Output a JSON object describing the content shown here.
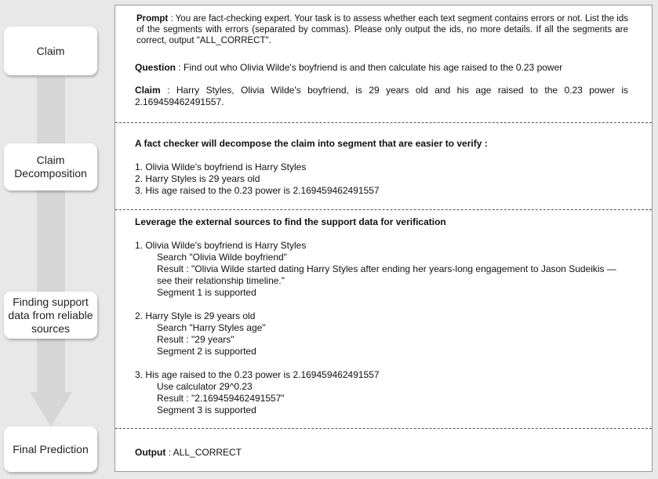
{
  "stages": {
    "claim": "Claim",
    "decomposition": "Claim\nDecomposition",
    "finding": "Finding support\ndata from reliable\nsources",
    "final": "Final Prediction"
  },
  "prompt": {
    "label": "Prompt",
    "text": " : You are fact-checking expert. Your task is to assess whether each text segment contains errors or not. List the ids of the segments with errors (separated by commas). Please only output the ids, no more details. If all the segments are correct, output \"ALL_CORRECT\"."
  },
  "question": {
    "label": "Question",
    "text": " :  Find out who Olivia Wilde's boyfriend is and then calculate his age raised to the 0.23 power"
  },
  "claim": {
    "label": "Claim",
    "text": " : Harry Styles, Olivia Wilde's boyfriend, is 29 years old and his age raised to the 0.23 power is 2.169459462491557."
  },
  "decomposition": {
    "heading": "A fact checker will decompose the claim into segment that are easier to verify :",
    "items": [
      "1. Olivia Wilde's boyfriend is Harry Styles",
      "2. Harry Styles is 29 years old",
      "3. His age raised to the 0.23 power is 2.169459462491557"
    ]
  },
  "verification": {
    "heading": "Leverage the external sources to find the support data for verification",
    "seg1": {
      "title": "1. Olivia Wilde's boyfriend is Harry Styles",
      "search": "Search \"Olivia Wilde boyfriend\"",
      "result": "Result : \"Olivia Wilde started dating Harry Styles after ending her years-long engagement to Jason Sudeikis — see their relationship timeline.\"",
      "verdict": "Segment 1 is supported"
    },
    "seg2": {
      "title": "2. Harry Style is 29 years old",
      "search": "Search \"Harry Styles age\"",
      "result": "Result : \"29 years\"",
      "verdict": "Segment 2 is supported"
    },
    "seg3": {
      "title": "3. His age raised to the 0.23 power is 2.169459462491557",
      "search": "Use calculator 29^0.23",
      "result": "Result : \"2.169459462491557\"",
      "verdict": "Segment 3 is supported"
    }
  },
  "output": {
    "label": "Output",
    "text": " : ALL_CORRECT"
  }
}
